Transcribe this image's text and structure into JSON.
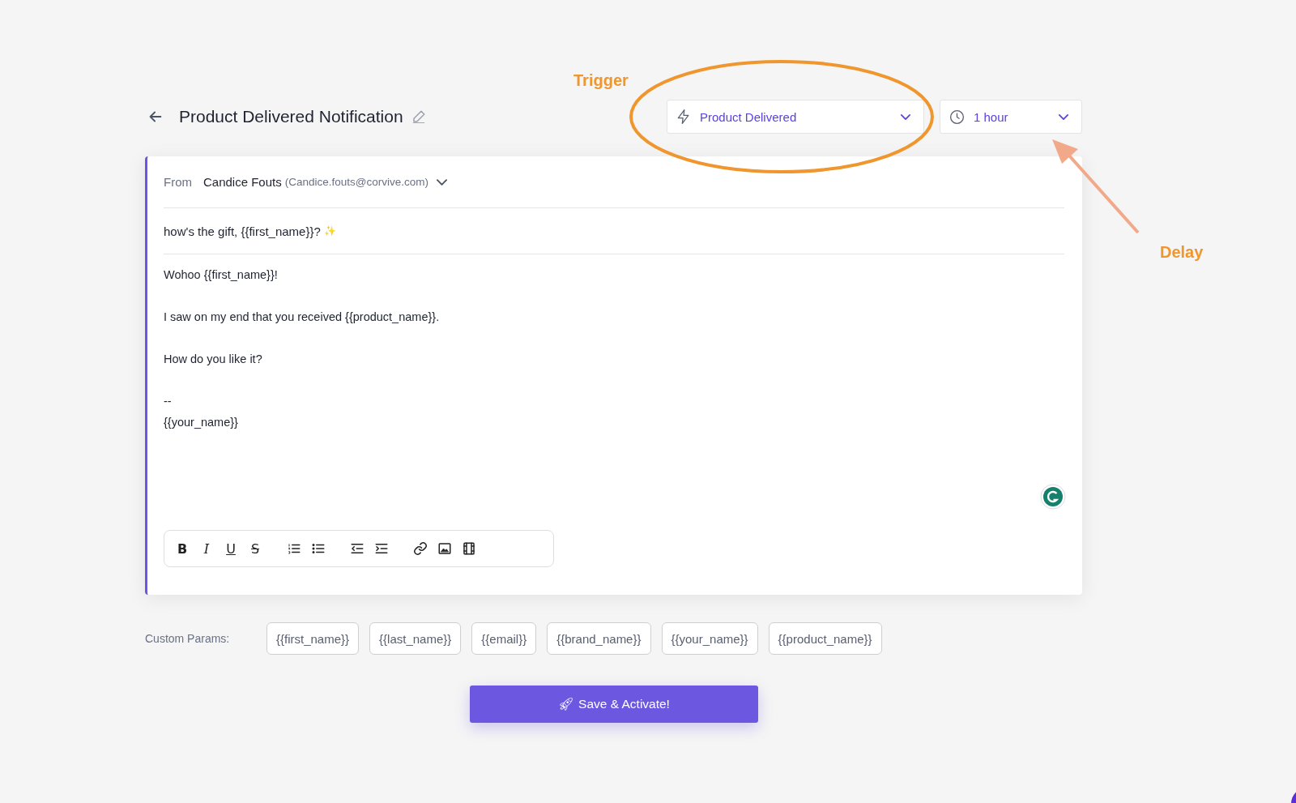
{
  "header": {
    "title": "Product Delivered Notification"
  },
  "trigger": {
    "value": "Product Delivered"
  },
  "delay": {
    "value": "1 hour"
  },
  "annotations": [
    {
      "kind": "trigger",
      "label": "Trigger"
    },
    {
      "kind": "delay",
      "label": "Delay"
    }
  ],
  "email": {
    "from_label": "From",
    "sender_name": "Candice Fouts",
    "sender_email": "(Candice.fouts@corvive.com)",
    "subject": "how's the gift, {{first_name}}?",
    "subject_emoji": "✨",
    "body": [
      {
        "lines": [
          "Wohoo {{first_name}}!"
        ]
      },
      {
        "lines": [
          "I saw on my end that you received {{product_name}}."
        ]
      },
      {
        "lines": [
          "How do you like it?"
        ]
      },
      {
        "lines": [
          "--",
          "{{your_name}}"
        ]
      }
    ]
  },
  "toolbar": [
    [
      {
        "kind": "bold",
        "label": "B"
      },
      {
        "kind": "italic",
        "label": "I"
      },
      {
        "kind": "underline",
        "label": "U"
      },
      {
        "kind": "strike",
        "label": "S"
      }
    ],
    [
      {
        "kind": "ordered-list"
      },
      {
        "kind": "bullet-list"
      }
    ],
    [
      {
        "kind": "outdent"
      },
      {
        "kind": "indent"
      }
    ],
    [
      {
        "kind": "link"
      },
      {
        "kind": "image"
      },
      {
        "kind": "video"
      }
    ]
  ],
  "custom_params": {
    "label": "Custom Params:",
    "params": [
      "{{first_name}}",
      "{{last_name}}",
      "{{email}}",
      "{{brand_name}}",
      "{{your_name}}",
      "{{product_name}}"
    ]
  },
  "save_button": {
    "icon": "🚀",
    "label": "Save & Activate!"
  }
}
